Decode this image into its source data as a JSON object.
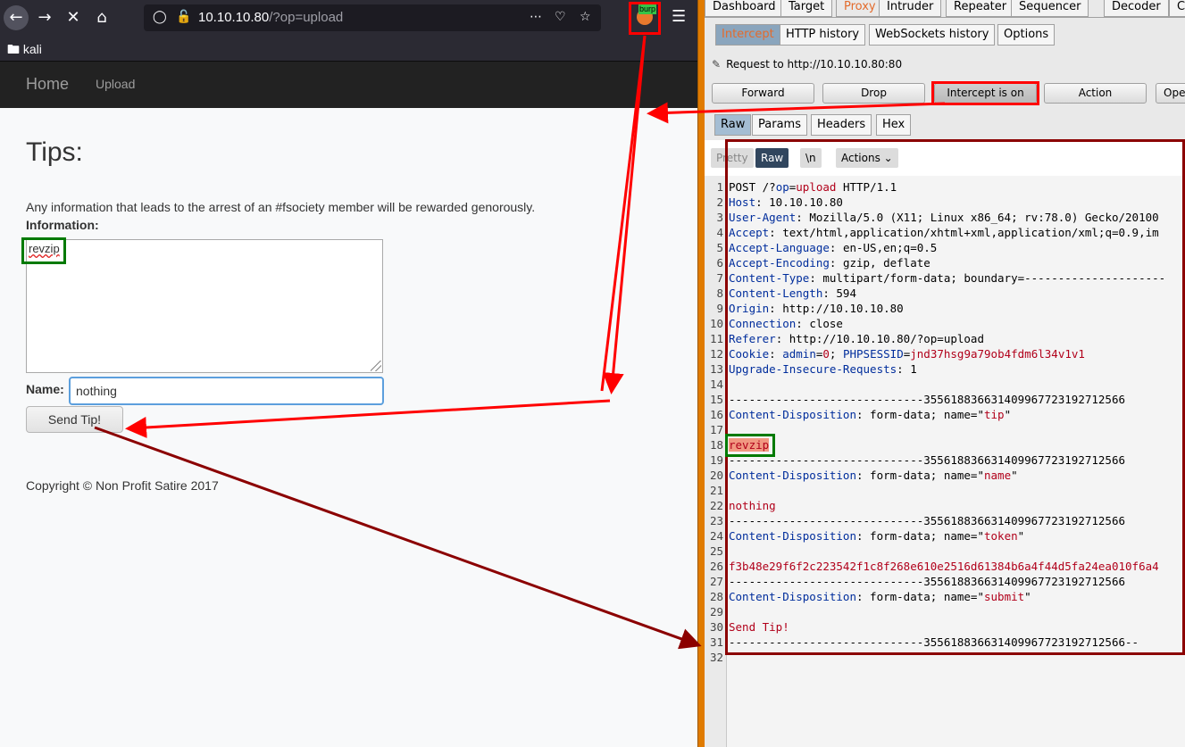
{
  "browser": {
    "url_host": "10.10.10.80",
    "url_path": "/?op=upload",
    "bookmark": "kali",
    "extension_badge": "burp"
  },
  "site": {
    "nav_home": "Home",
    "nav_upload": "Upload",
    "title": "Tips:",
    "info_text": "Any information that leads to the arrest of an #fsociety member will be rewarded genorously.",
    "info_label": "Information:",
    "tip_value": "revzip",
    "name_label": "Name:",
    "name_value": "nothing",
    "send_button": "Send Tip!",
    "copyright": "Copyright © Non Profit Satire 2017"
  },
  "burp": {
    "main_tabs": [
      "Dashboard",
      "Target",
      "Proxy",
      "Intruder",
      "Repeater",
      "Sequencer",
      "Decoder",
      "Co"
    ],
    "proxy_tabs": [
      "Intercept",
      "HTTP history",
      "WebSockets history",
      "Options"
    ],
    "request_to": "Request to http://10.10.10.80:80",
    "buttons": {
      "forward": "Forward",
      "drop": "Drop",
      "intercept": "Intercept is on",
      "action": "Action",
      "open": "Ope"
    },
    "view_tabs": [
      "Raw",
      "Params",
      "Headers",
      "Hex"
    ],
    "editor_toolbar": {
      "pretty": "Pretty",
      "raw": "Raw",
      "newline": "\\n",
      "actions": "Actions"
    },
    "request_lines": [
      {
        "n": "1",
        "plain": "POST /?",
        "k": "op",
        "eq": "=",
        "r": "upload",
        "tail": " HTTP/1.1"
      },
      {
        "n": "2",
        "k": "Host",
        "v": ": 10.10.10.80"
      },
      {
        "n": "3",
        "k": "User-Agent",
        "v": ": Mozilla/5.0 (X11; Linux x86_64; rv:78.0) Gecko/20100"
      },
      {
        "n": "4",
        "k": "Accept",
        "v": ": text/html,application/xhtml+xml,application/xml;q=0.9,im"
      },
      {
        "n": "5",
        "k": "Accept-Language",
        "v": ": en-US,en;q=0.5"
      },
      {
        "n": "6",
        "k": "Accept-Encoding",
        "v": ": gzip, deflate"
      },
      {
        "n": "7",
        "k": "Content-Type",
        "v": ": multipart/form-data; boundary=---------------------"
      },
      {
        "n": "8",
        "k": "Content-Length",
        "v": ": 594"
      },
      {
        "n": "9",
        "k": "Origin",
        "v": ": http://10.10.10.80"
      },
      {
        "n": "10",
        "k": "Connection",
        "v": ": close"
      },
      {
        "n": "11",
        "k": "Referer",
        "v": ": http://10.10.10.80/?op=upload"
      },
      {
        "n": "12",
        "k": "Cookie",
        "v": ": ",
        "k2": "admin",
        "eq": "=",
        "r": "0",
        "sep": "; ",
        "k3": "PHPSESSID",
        "eq2": "=",
        "r2": "jnd37hsg9a79ob4fdm6l34v1v1"
      },
      {
        "n": "13",
        "k": "Upgrade-Insecure-Requests",
        "v": ": 1"
      },
      {
        "n": "14"
      },
      {
        "n": "15",
        "plain": "-----------------------------355618836631409967723192712566"
      },
      {
        "n": "16",
        "k": "Content-Disposition",
        "v": ": form-data; name=\"",
        "r": "tip",
        "tail": "\""
      },
      {
        "n": "17"
      },
      {
        "n": "18",
        "hl": "revzip"
      },
      {
        "n": "19",
        "plain": "-----------------------------355618836631409967723192712566"
      },
      {
        "n": "20",
        "k": "Content-Disposition",
        "v": ": form-data; name=\"",
        "r": "name",
        "tail": "\""
      },
      {
        "n": "21"
      },
      {
        "n": "22",
        "r": "nothing"
      },
      {
        "n": "23",
        "plain": "-----------------------------355618836631409967723192712566"
      },
      {
        "n": "24",
        "k": "Content-Disposition",
        "v": ": form-data; name=\"",
        "r": "token",
        "tail": "\""
      },
      {
        "n": "25"
      },
      {
        "n": "26",
        "r": "f3b48e29f6f2c223542f1c8f268e610e2516d61384b6a4f44d5fa24ea010f6a4"
      },
      {
        "n": "27",
        "plain": "-----------------------------355618836631409967723192712566"
      },
      {
        "n": "28",
        "k": "Content-Disposition",
        "v": ": form-data; name=\"",
        "r": "submit",
        "tail": "\""
      },
      {
        "n": "29"
      },
      {
        "n": "30",
        "r": "Send Tip!"
      },
      {
        "n": "31",
        "plain": "-----------------------------355618836631409967723192712566--"
      },
      {
        "n": "32"
      }
    ]
  },
  "colors": {
    "annotation_red": "#ff0000",
    "annotation_dark_red": "#8b0000",
    "annotation_green": "#007a00",
    "burp_accent": "#e36b2c"
  }
}
